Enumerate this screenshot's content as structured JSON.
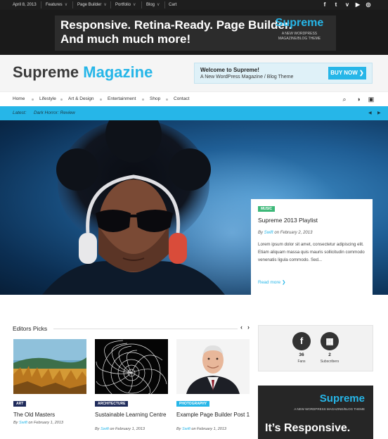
{
  "topbar": {
    "date": "April 8, 2013",
    "menu": [
      "Features",
      "Page Builder",
      "Portfolio",
      "Blog",
      "Cart"
    ],
    "social_icons": [
      "facebook-icon",
      "twitter-icon",
      "vimeo-icon",
      "youtube-icon",
      "dribbble-icon"
    ],
    "social_glyphs": [
      "f",
      "t",
      "v",
      "▶",
      "◎"
    ]
  },
  "banner": {
    "line1": "Responsive. Retina-Ready. Page Builder.",
    "line2": "And much much more!",
    "brand": "Supreme",
    "brand_sub": "A NEW WORDPRESS MAGAZINE/BLOG THEME"
  },
  "header": {
    "logo_part1": "Supreme",
    "logo_part2": "Magazine",
    "welcome_title": "Welcome to Supreme!",
    "welcome_sub": "A New WordPress Magazine / Blog Theme",
    "buy_label": "BUY NOW",
    "buy_arrow": "❯"
  },
  "nav": {
    "items": [
      "Home",
      "Lifestyle",
      "Art & Design",
      "Entertainment",
      "Shop",
      "Contact"
    ],
    "search_glyph": "⌕",
    "globe_glyph": "◑",
    "lock_glyph": "▣"
  },
  "latest": {
    "label": "Latest:",
    "title": "Dark Horror: Review",
    "prev": "◀",
    "next": "▶"
  },
  "featured": {
    "tag": "MUSIC",
    "tag_color": "#3cb878",
    "title": "Supreme 2013 Playlist",
    "by": "By",
    "author": "Swift",
    "date": "on February 2, 2013",
    "excerpt": "Lorem ipsum dolor sit amet, consectetur adipiscing elit. Etiam aliquam massa quis mauris sollicitudin commodo venenatis ligula commodo. Sed...",
    "more": "Read more ❯"
  },
  "editors_picks": {
    "title": "Editors Picks",
    "prev": "‹",
    "next": "›",
    "posts": [
      {
        "tag": "ART",
        "tag_color": "#1e2a5a",
        "title": "The Old Masters",
        "by": "By",
        "author": "Swift",
        "date": "on February 1, 2013"
      },
      {
        "tag": "ARCHITECTURE",
        "tag_color": "#1e2a5a",
        "title": "Sustainable Learning Centre",
        "by": "By",
        "author": "Swift",
        "date": "on February 1, 2013"
      },
      {
        "tag": "PHOTOGRAPHY",
        "tag_color": "#26b6e8",
        "title": "Example Page Builder Post 1",
        "by": "By",
        "author": "Swift",
        "date": "on February 1, 2013"
      }
    ]
  },
  "sidebar": {
    "fans_count": "36",
    "fans_label": "Fans",
    "fans_glyph": "f",
    "subscribers_count": "2",
    "subscribers_label": "Subscribers",
    "subscribers_glyph": "▦",
    "ad_brand": "Supreme",
    "ad_sub": "A NEW WORDPRESS MAGAZINE/BLOG THEME",
    "ad_big": "It’s Responsive."
  },
  "colors": {
    "accent": "#26b6e8",
    "dark": "#1e1e1e"
  }
}
